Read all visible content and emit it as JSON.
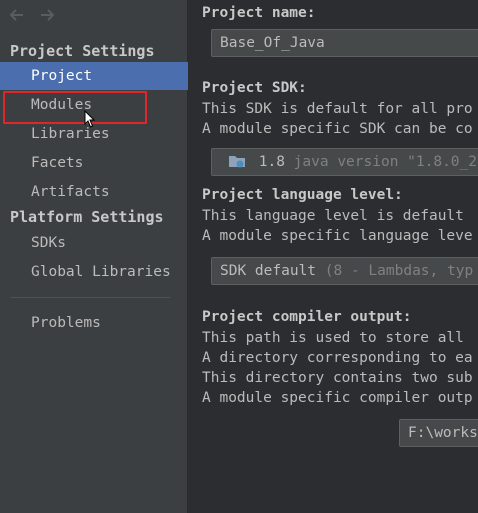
{
  "sidebar": {
    "project_settings_header": "Project Settings",
    "project_settings_items": [
      {
        "label": "Project"
      },
      {
        "label": "Modules"
      },
      {
        "label": "Libraries"
      },
      {
        "label": "Facets"
      },
      {
        "label": "Artifacts"
      }
    ],
    "platform_settings_header": "Platform Settings",
    "platform_settings_items": [
      {
        "label": "SDKs"
      },
      {
        "label": "Global Libraries"
      }
    ],
    "problems_label": "Problems"
  },
  "main": {
    "project_name": {
      "label": "Project name:",
      "value": "Base_Of_Java"
    },
    "project_sdk": {
      "label": "Project SDK:",
      "desc_lines": [
        "This SDK is default for all pro",
        "A module specific SDK can be co"
      ],
      "version": "1.8",
      "detail": "java version \"1.8.0_2"
    },
    "language_level": {
      "label": "Project language level:",
      "desc_lines": [
        "This language level is default",
        "A module specific language leve"
      ],
      "value": "SDK default",
      "detail": "(8 - Lambdas, typ"
    },
    "compiler_output": {
      "label": "Project compiler output:",
      "desc_lines": [
        "This path is used to store all",
        "A directory corresponding to ea",
        "This directory contains two sub",
        "A module specific compiler outp"
      ],
      "value": "F:\\workspace\\out"
    }
  },
  "colors": {
    "selection": "#4b6eaf",
    "highlight_box": "#e0262a",
    "sidebar_bg": "#3c3f41",
    "main_bg": "#2b2d30"
  }
}
